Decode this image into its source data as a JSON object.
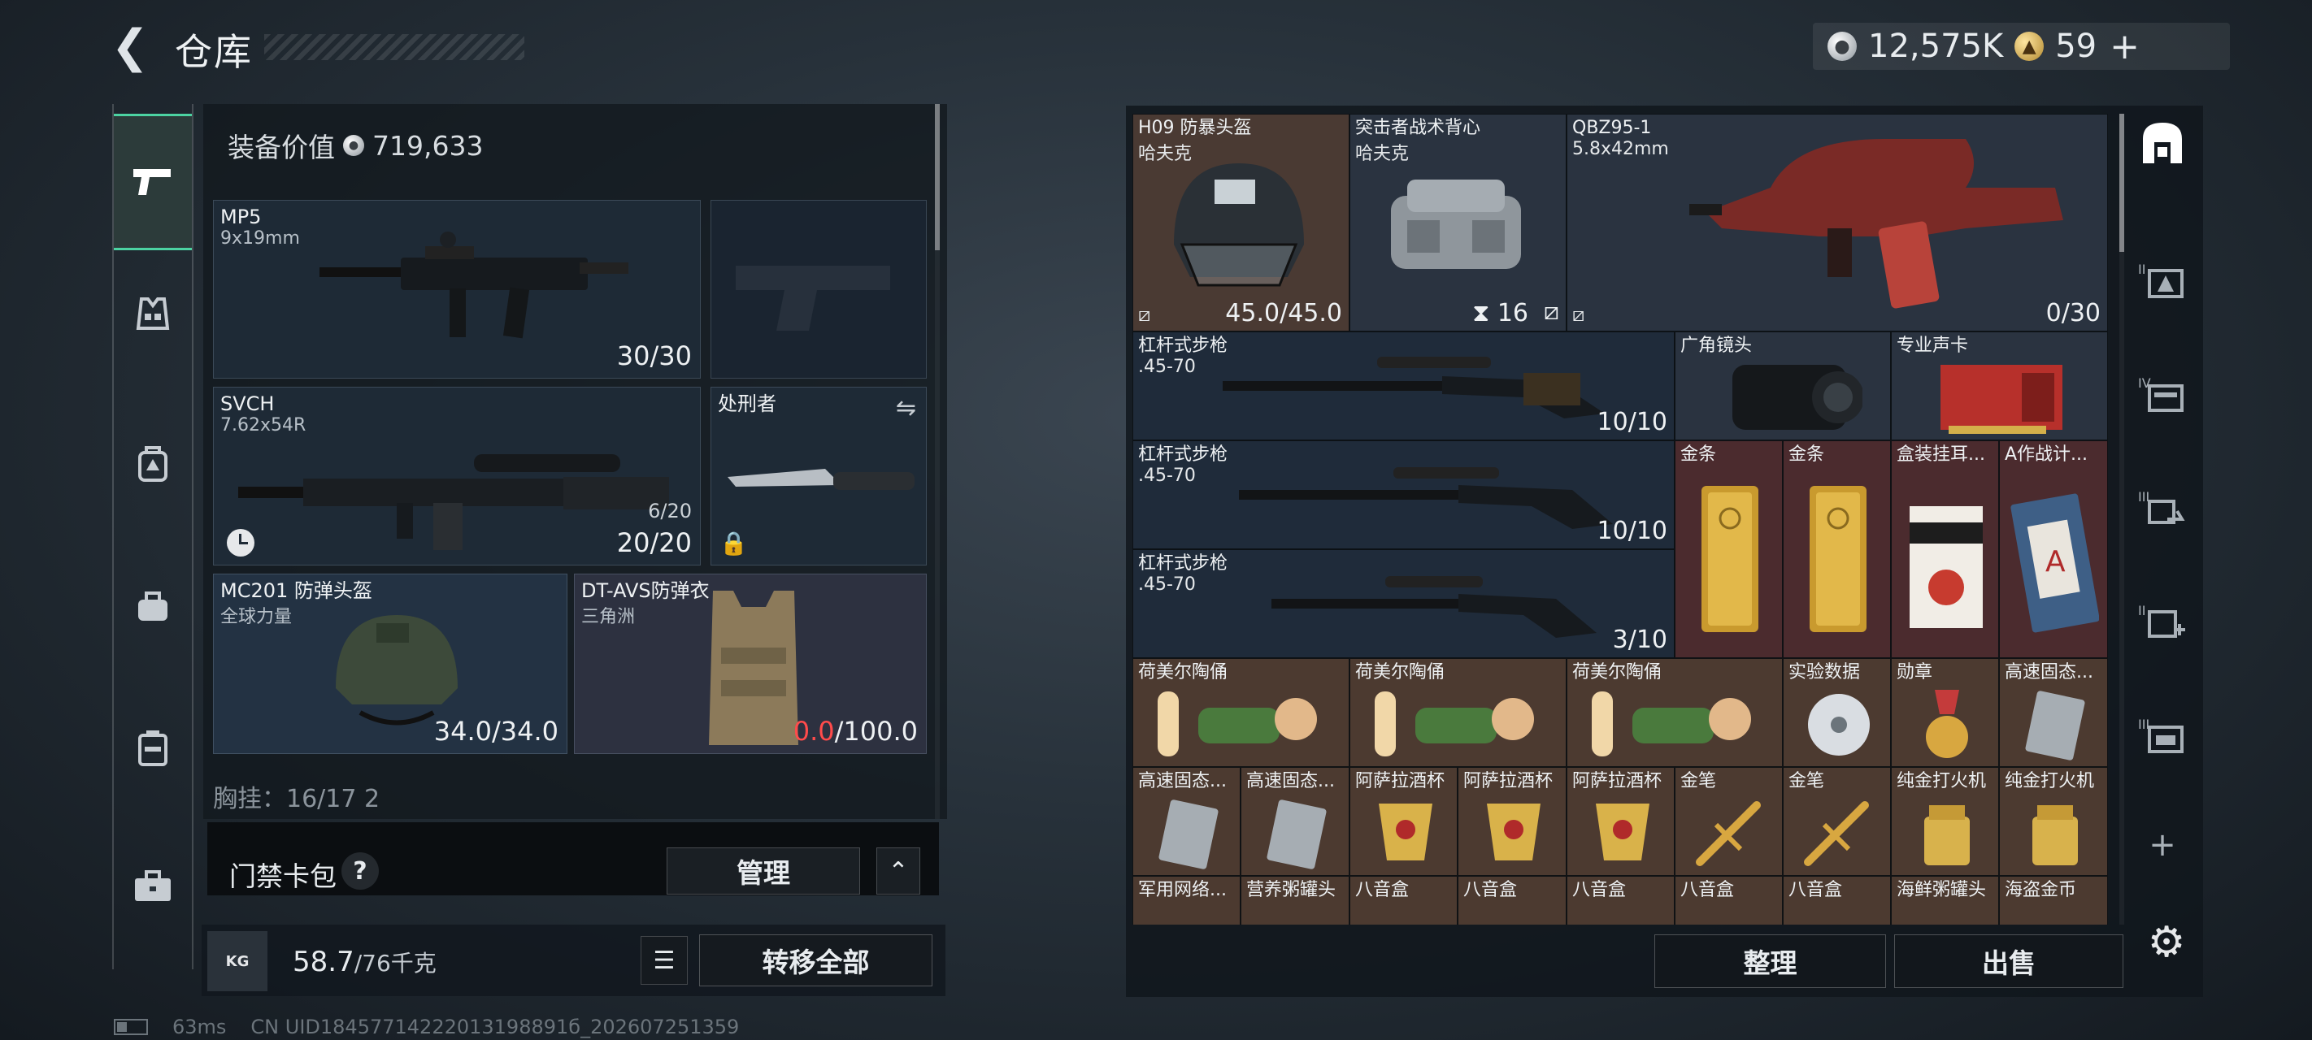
{
  "header": {
    "back_glyph": "❮",
    "title": "仓库",
    "currency": {
      "silver": "12,575K",
      "gold": "59",
      "gold_plus": "+"
    }
  },
  "equipment": {
    "label": "装备价值",
    "value": "719,633",
    "slots": {
      "mp5": {
        "name": "MP5",
        "caliber": "9x19mm",
        "count": "30/30"
      },
      "svch": {
        "name": "SVCH",
        "caliber": "7.62x54R",
        "mag": "6/20",
        "count": "20/20"
      },
      "knife": {
        "name": "处刑者"
      },
      "helmet": {
        "name": "MC201 防弹头盔",
        "brand": "全球力量",
        "durability": "34.0/34.0"
      },
      "armor": {
        "name": "DT-AVS防弹衣",
        "brand": "三角洲",
        "durability_current": "0.0",
        "durability_max": "/100.0"
      }
    },
    "rig_row": "胸挂：16/17  2"
  },
  "keycard": {
    "label": "门禁卡包",
    "help": "?",
    "manage": "管理",
    "caret": "⌃"
  },
  "weight": {
    "kg_icon": "KG",
    "current": "58.7",
    "max": "/76千克",
    "transfer_all": "转移全部",
    "list_glyph": "☰"
  },
  "status": {
    "ping": "63ms",
    "uid": "CN UID18457714222013198891б_202607251359"
  },
  "stash": {
    "items": [
      {
        "id": "h09",
        "name": "H09 防暴头盔",
        "sub": "哈夫克",
        "count": "45.0/45.0"
      },
      {
        "id": "vest",
        "name": "突击者战术背心",
        "sub": "哈夫克",
        "count": "16"
      },
      {
        "id": "qbz",
        "name": "QBZ95-1",
        "sub": "5.8x42mm",
        "count": "0/30"
      },
      {
        "id": "lever1",
        "name": "杠杆式步枪",
        "sub": ".45-70",
        "count": "10/10"
      },
      {
        "id": "lens",
        "name": "广角镜头"
      },
      {
        "id": "soundcard",
        "name": "专业声卡"
      },
      {
        "id": "lever2",
        "name": "杠杆式步枪",
        "sub": ".45-70",
        "count": "10/10"
      },
      {
        "id": "gold1",
        "name": "金条"
      },
      {
        "id": "gold2",
        "name": "金条"
      },
      {
        "id": "coffee",
        "name": "盒装挂耳..."
      },
      {
        "id": "manual",
        "name": "A作战计..."
      },
      {
        "id": "lever3",
        "name": "杠杆式步枪",
        "sub": ".45-70",
        "count": "3/10"
      },
      {
        "id": "figure1",
        "name": "荷美尔陶俑"
      },
      {
        "id": "figure2",
        "name": "荷美尔陶俑"
      },
      {
        "id": "figure3",
        "name": "荷美尔陶俑"
      },
      {
        "id": "disc",
        "name": "实验数据"
      },
      {
        "id": "medal",
        "name": "勋章"
      },
      {
        "id": "ssd1",
        "name": "高速固态..."
      },
      {
        "id": "ssd2",
        "name": "高速固态..."
      },
      {
        "id": "ssd3",
        "name": "高速固态..."
      },
      {
        "id": "cup1",
        "name": "阿萨拉酒杯"
      },
      {
        "id": "cup2",
        "name": "阿萨拉酒杯"
      },
      {
        "id": "cup3",
        "name": "阿萨拉酒杯"
      },
      {
        "id": "pen1",
        "name": "金笔"
      },
      {
        "id": "pen2",
        "name": "金笔"
      },
      {
        "id": "lighter1",
        "name": "纯金打火机"
      },
      {
        "id": "lighter2",
        "name": "纯金打火机"
      },
      {
        "id": "net",
        "name": "军用网络..."
      },
      {
        "id": "can1",
        "name": "营养粥罐头"
      },
      {
        "id": "box1",
        "name": "八音盒"
      },
      {
        "id": "box2",
        "name": "八音盒"
      },
      {
        "id": "box3",
        "name": "八音盒"
      },
      {
        "id": "box4",
        "name": "八音盒"
      },
      {
        "id": "box5",
        "name": "八音盒"
      },
      {
        "id": "can2",
        "name": "海鲜粥罐头"
      },
      {
        "id": "coin",
        "name": "海盗金币"
      }
    ],
    "sort_label": "整理",
    "sell_label": "出售"
  },
  "right_nav": {
    "add_glyph": "+"
  },
  "icons": {
    "pistol": "pistol-icon",
    "vest": "vest-icon",
    "backpack": "backpack-icon",
    "bag": "bag-icon",
    "case": "case-icon",
    "toolbox": "toolbox-icon",
    "settings": "gear-icon"
  },
  "colors": {
    "accent": "#4cd3a2",
    "danger": "#ff4b4b",
    "gold_rarity": "#4b2b2e",
    "purple_rarity": "#3a3446"
  }
}
